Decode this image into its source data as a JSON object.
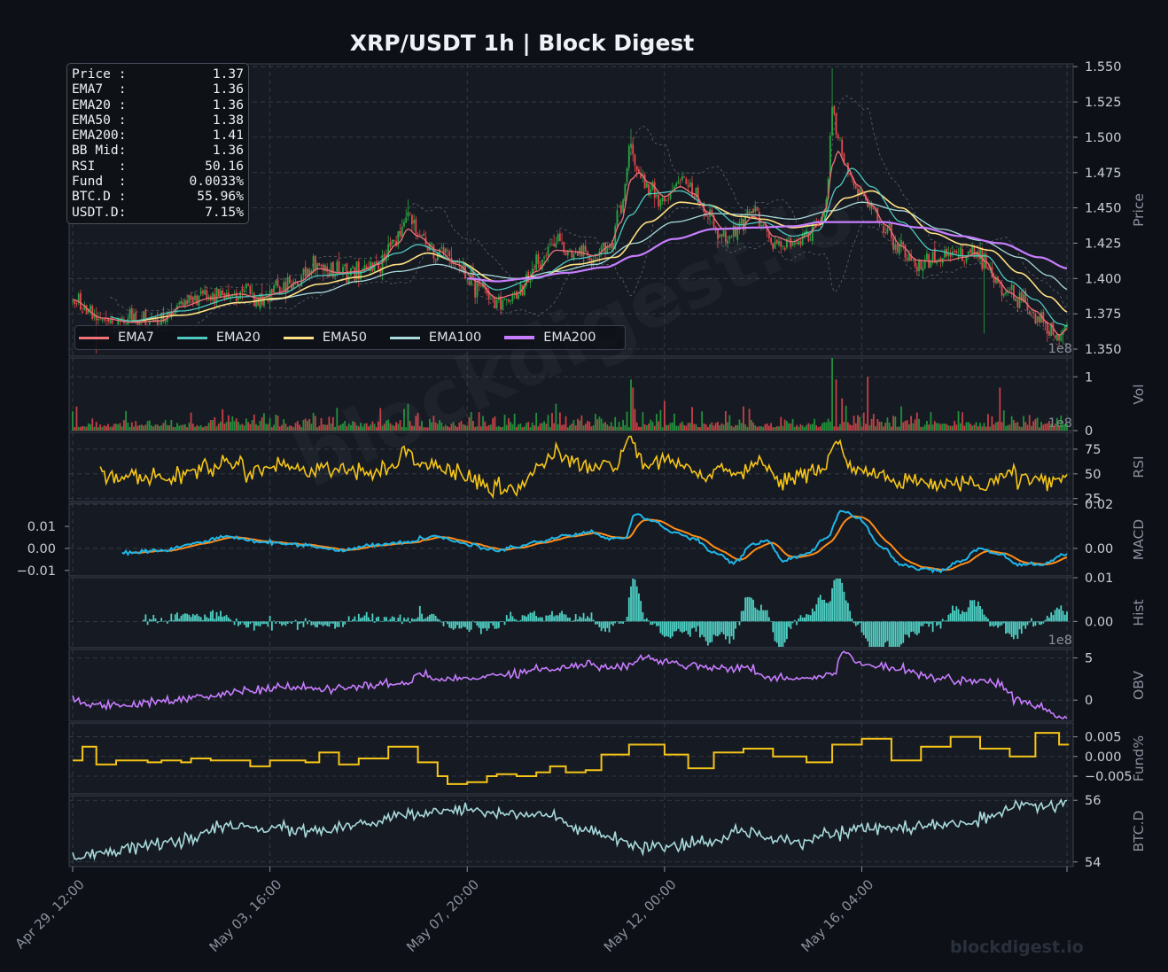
{
  "title": "XRP/USDT  1h  |  Block Digest",
  "watermark": "blockdigest.io",
  "footer_brand": "blockdigest.io",
  "info_box": [
    {
      "label": "Price :",
      "value": "1.37"
    },
    {
      "label": "EMA7  :",
      "value": "1.36"
    },
    {
      "label": "EMA20 :",
      "value": "1.36"
    },
    {
      "label": "EMA50 :",
      "value": "1.38"
    },
    {
      "label": "EMA200:",
      "value": "1.41"
    },
    {
      "label": "BB Mid:",
      "value": "1.36"
    },
    {
      "label": "RSI   :",
      "value": "50.16"
    },
    {
      "label": "Fund  :",
      "value": "0.0033%"
    },
    {
      "label": "BTC.D :",
      "value": "55.96%"
    },
    {
      "label": "USDT.D:",
      "value": "7.15%"
    }
  ],
  "chart_data": {
    "type": "line",
    "x_ticks": [
      "Apr 29, 12:00",
      "May 03, 16:00",
      "May 07, 20:00",
      "May 12, 00:00",
      "May 16, 04:00"
    ],
    "bars": 505,
    "colors": {
      "up": "#26a641",
      "down": "#e5484d",
      "ema7": "#f07178",
      "ema20": "#4ec9c0",
      "ema50": "#ffe082",
      "ema100": "#a8dadc",
      "ema200": "#c77dff",
      "rsi": "#f5c518",
      "macd": "#1fb6e8",
      "signal": "#ff8c1a",
      "hist": "#4fd1c5",
      "obv": "#c77dff",
      "fund": "#f5c518",
      "btcd": "#a8dadc"
    },
    "legend": [
      "EMA7",
      "EMA20",
      "EMA50",
      "EMA100",
      "EMA200"
    ],
    "panels": [
      {
        "id": "price",
        "ylabel": "Price",
        "ticks": [
          "1.350",
          "1.375",
          "1.400",
          "1.425",
          "1.450",
          "1.475",
          "1.500",
          "1.525",
          "1.550"
        ],
        "ylim": [
          1.345,
          1.552
        ],
        "offset_text": "1e8",
        "series_knots": {
          "close": [
            [
              0,
              1.385
            ],
            [
              15,
              1.37
            ],
            [
              30,
              1.368
            ],
            [
              45,
              1.37
            ],
            [
              55,
              1.382
            ],
            [
              70,
              1.388
            ],
            [
              85,
              1.39
            ],
            [
              95,
              1.385
            ],
            [
              105,
              1.392
            ],
            [
              115,
              1.4
            ],
            [
              125,
              1.41
            ],
            [
              135,
              1.404
            ],
            [
              145,
              1.405
            ],
            [
              155,
              1.41
            ],
            [
              165,
              1.43
            ],
            [
              170,
              1.445
            ],
            [
              175,
              1.428
            ],
            [
              185,
              1.42
            ],
            [
              195,
              1.408
            ],
            [
              205,
              1.395
            ],
            [
              215,
              1.383
            ],
            [
              225,
              1.388
            ],
            [
              235,
              1.41
            ],
            [
              245,
              1.425
            ],
            [
              255,
              1.42
            ],
            [
              265,
              1.415
            ],
            [
              272,
              1.425
            ],
            [
              278,
              1.45
            ],
            [
              283,
              1.495
            ],
            [
              287,
              1.475
            ],
            [
              292,
              1.465
            ],
            [
              300,
              1.455
            ],
            [
              308,
              1.47
            ],
            [
              315,
              1.46
            ],
            [
              322,
              1.445
            ],
            [
              330,
              1.43
            ],
            [
              338,
              1.435
            ],
            [
              345,
              1.448
            ],
            [
              350,
              1.44
            ],
            [
              355,
              1.425
            ],
            [
              365,
              1.425
            ],
            [
              372,
              1.43
            ],
            [
              378,
              1.44
            ],
            [
              382,
              1.455
            ],
            [
              385,
              1.52
            ],
            [
              388,
              1.505
            ],
            [
              392,
              1.48
            ],
            [
              398,
              1.462
            ],
            [
              405,
              1.45
            ],
            [
              412,
              1.435
            ],
            [
              420,
              1.42
            ],
            [
              428,
              1.41
            ],
            [
              436,
              1.412
            ],
            [
              444,
              1.414
            ],
            [
              452,
              1.416
            ],
            [
              458,
              1.42
            ],
            [
              463,
              1.41
            ],
            [
              468,
              1.395
            ],
            [
              475,
              1.388
            ],
            [
              480,
              1.385
            ],
            [
              488,
              1.375
            ],
            [
              495,
              1.365
            ],
            [
              500,
              1.356
            ],
            [
              505,
              1.37
            ]
          ],
          "ema7": [
            [
              0,
              1.385
            ],
            [
              15,
              1.372
            ],
            [
              30,
              1.369
            ],
            [
              45,
              1.37
            ],
            [
              55,
              1.38
            ],
            [
              70,
              1.386
            ],
            [
              85,
              1.389
            ],
            [
              95,
              1.386
            ],
            [
              105,
              1.39
            ],
            [
              115,
              1.398
            ],
            [
              125,
              1.407
            ],
            [
              135,
              1.404
            ],
            [
              145,
              1.405
            ],
            [
              155,
              1.41
            ],
            [
              165,
              1.425
            ],
            [
              170,
              1.435
            ],
            [
              175,
              1.43
            ],
            [
              185,
              1.42
            ],
            [
              195,
              1.41
            ],
            [
              205,
              1.398
            ],
            [
              215,
              1.386
            ],
            [
              225,
              1.389
            ],
            [
              235,
              1.405
            ],
            [
              245,
              1.42
            ],
            [
              255,
              1.419
            ],
            [
              265,
              1.416
            ],
            [
              272,
              1.423
            ],
            [
              278,
              1.44
            ],
            [
              283,
              1.47
            ],
            [
              287,
              1.475
            ],
            [
              292,
              1.468
            ],
            [
              300,
              1.458
            ],
            [
              308,
              1.465
            ],
            [
              315,
              1.46
            ],
            [
              322,
              1.447
            ],
            [
              330,
              1.435
            ],
            [
              338,
              1.435
            ],
            [
              345,
              1.444
            ],
            [
              350,
              1.44
            ],
            [
              355,
              1.43
            ],
            [
              365,
              1.426
            ],
            [
              372,
              1.43
            ],
            [
              378,
              1.438
            ],
            [
              382,
              1.45
            ],
            [
              385,
              1.48
            ],
            [
              388,
              1.49
            ],
            [
              392,
              1.48
            ],
            [
              398,
              1.466
            ],
            [
              405,
              1.452
            ],
            [
              412,
              1.438
            ],
            [
              420,
              1.423
            ],
            [
              428,
              1.413
            ],
            [
              436,
              1.412
            ],
            [
              444,
              1.413
            ],
            [
              452,
              1.415
            ],
            [
              458,
              1.418
            ],
            [
              463,
              1.412
            ],
            [
              468,
              1.4
            ],
            [
              475,
              1.39
            ],
            [
              480,
              1.386
            ],
            [
              488,
              1.377
            ],
            [
              495,
              1.368
            ],
            [
              500,
              1.36
            ],
            [
              505,
              1.365
            ]
          ],
          "ema20": [
            [
              0,
              1.38
            ],
            [
              30,
              1.37
            ],
            [
              55,
              1.377
            ],
            [
              85,
              1.387
            ],
            [
              105,
              1.389
            ],
            [
              125,
              1.402
            ],
            [
              145,
              1.404
            ],
            [
              165,
              1.418
            ],
            [
              175,
              1.424
            ],
            [
              195,
              1.412
            ],
            [
              215,
              1.392
            ],
            [
              235,
              1.4
            ],
            [
              255,
              1.414
            ],
            [
              272,
              1.418
            ],
            [
              283,
              1.445
            ],
            [
              292,
              1.46
            ],
            [
              308,
              1.462
            ],
            [
              322,
              1.452
            ],
            [
              338,
              1.438
            ],
            [
              350,
              1.44
            ],
            [
              365,
              1.43
            ],
            [
              378,
              1.434
            ],
            [
              388,
              1.465
            ],
            [
              395,
              1.478
            ],
            [
              405,
              1.465
            ],
            [
              420,
              1.44
            ],
            [
              436,
              1.42
            ],
            [
              452,
              1.416
            ],
            [
              463,
              1.416
            ],
            [
              475,
              1.398
            ],
            [
              488,
              1.385
            ],
            [
              500,
              1.368
            ],
            [
              505,
              1.366
            ]
          ],
          "ema50": [
            [
              30,
              1.37
            ],
            [
              55,
              1.374
            ],
            [
              85,
              1.383
            ],
            [
              105,
              1.386
            ],
            [
              125,
              1.396
            ],
            [
              145,
              1.401
            ],
            [
              165,
              1.41
            ],
            [
              180,
              1.418
            ],
            [
              195,
              1.412
            ],
            [
              215,
              1.398
            ],
            [
              235,
              1.401
            ],
            [
              255,
              1.41
            ],
            [
              275,
              1.415
            ],
            [
              292,
              1.44
            ],
            [
              308,
              1.454
            ],
            [
              322,
              1.452
            ],
            [
              338,
              1.444
            ],
            [
              350,
              1.442
            ],
            [
              365,
              1.436
            ],
            [
              378,
              1.438
            ],
            [
              392,
              1.457
            ],
            [
              405,
              1.462
            ],
            [
              420,
              1.45
            ],
            [
              436,
              1.432
            ],
            [
              452,
              1.424
            ],
            [
              465,
              1.42
            ],
            [
              480,
              1.404
            ],
            [
              495,
              1.387
            ],
            [
              505,
              1.376
            ]
          ],
          "ema100": [
            [
              100,
              1.385
            ],
            [
              125,
              1.39
            ],
            [
              145,
              1.398
            ],
            [
              165,
              1.405
            ],
            [
              185,
              1.41
            ],
            [
              205,
              1.403
            ],
            [
              225,
              1.4
            ],
            [
              245,
              1.405
            ],
            [
              265,
              1.41
            ],
            [
              285,
              1.425
            ],
            [
              305,
              1.44
            ],
            [
              325,
              1.446
            ],
            [
              345,
              1.445
            ],
            [
              365,
              1.442
            ],
            [
              385,
              1.448
            ],
            [
              400,
              1.454
            ],
            [
              420,
              1.448
            ],
            [
              440,
              1.435
            ],
            [
              460,
              1.427
            ],
            [
              480,
              1.415
            ],
            [
              495,
              1.402
            ],
            [
              505,
              1.392
            ]
          ],
          "ema200": [
            [
              200,
              1.4
            ],
            [
              215,
              1.398
            ],
            [
              230,
              1.4
            ],
            [
              250,
              1.404
            ],
            [
              270,
              1.408
            ],
            [
              285,
              1.416
            ],
            [
              305,
              1.428
            ],
            [
              325,
              1.435
            ],
            [
              345,
              1.436
            ],
            [
              365,
              1.437
            ],
            [
              380,
              1.44
            ],
            [
              395,
              1.44
            ],
            [
              410,
              1.44
            ],
            [
              430,
              1.436
            ],
            [
              450,
              1.43
            ],
            [
              470,
              1.425
            ],
            [
              490,
              1.415
            ],
            [
              505,
              1.407
            ]
          ]
        }
      },
      {
        "id": "vol",
        "ylabel": "Vol",
        "ticks": [
          "0",
          "1"
        ],
        "ylim": [
          0,
          1.35
        ],
        "offset_text": "1e8"
      },
      {
        "id": "rsi",
        "ylabel": "RSI",
        "ticks": [
          "25",
          "50",
          "75"
        ],
        "ylim": [
          22,
          92
        ]
      },
      {
        "id": "macd",
        "ylabel": "MACD",
        "ticks": [
          "0.00",
          "0.02"
        ],
        "left_ticks": [
          "−0.01",
          "0.00",
          "0.01"
        ],
        "ylim": [
          -0.0125,
          0.0205
        ]
      },
      {
        "id": "hist",
        "ylabel": "Hist",
        "ticks": [
          "0.00",
          "0.01"
        ],
        "ylim": [
          -0.006,
          0.01
        ],
        "offset_text": "1e8"
      },
      {
        "id": "obv",
        "ylabel": "OBV",
        "ticks": [
          "0",
          "5"
        ],
        "ylim": [
          -2.5,
          6
        ]
      },
      {
        "id": "fund",
        "ylabel": "Fund%",
        "ticks": [
          "−0.005",
          "0.000",
          "0.005"
        ],
        "ylim": [
          -0.0095,
          0.0085
        ]
      },
      {
        "id": "btcd",
        "ylabel": "BTC.D",
        "ticks": [
          "54",
          "56"
        ],
        "ylim": [
          53.85,
          56.15
        ]
      }
    ]
  }
}
